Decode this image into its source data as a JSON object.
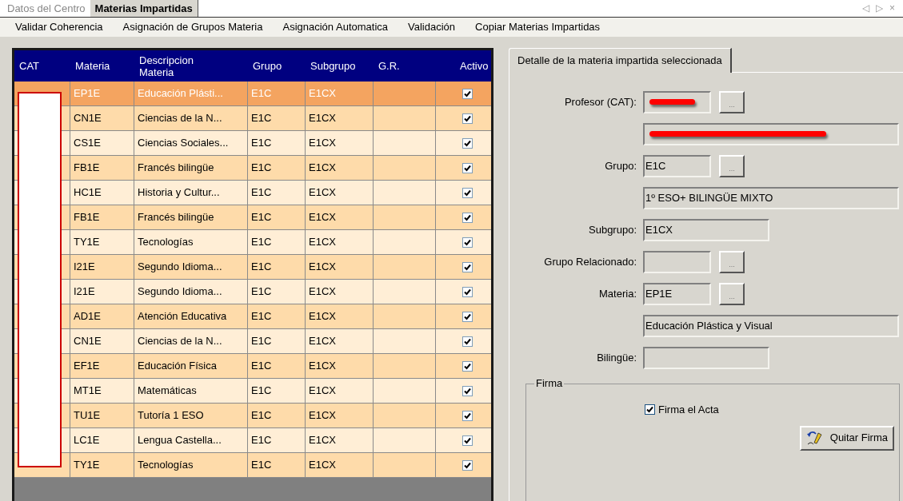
{
  "tabs": [
    {
      "label": "Datos del Centro",
      "selected": false
    },
    {
      "label": "Materias Impartidas",
      "selected": true
    }
  ],
  "nav_icons": [
    "◁",
    "▷",
    "×"
  ],
  "toolbar": [
    "Validar Coherencia",
    "Asignación de Grupos Materia",
    "Asignación Automatica",
    "Validación",
    "Copiar Materias Impartidas"
  ],
  "table": {
    "columns": [
      "CAT",
      "Materia",
      "Descripcion Materia",
      "Grupo",
      "Subgrupo",
      "G.R.",
      "Activo"
    ],
    "cat_redacted": true,
    "rows": [
      {
        "materia": "EP1E",
        "descripcion": "Educación Plásti...",
        "grupo": "E1C",
        "subgrupo": "E1CX",
        "activo": true,
        "selected": true
      },
      {
        "materia": "CN1E",
        "descripcion": "Ciencias de la N...",
        "grupo": "E1C",
        "subgrupo": "E1CX",
        "activo": true,
        "selected": false
      },
      {
        "materia": "CS1E",
        "descripcion": "Ciencias Sociales...",
        "grupo": "E1C",
        "subgrupo": "E1CX",
        "activo": true,
        "selected": false
      },
      {
        "materia": "FB1E",
        "descripcion": "Francés bilingüe",
        "grupo": "E1C",
        "subgrupo": "E1CX",
        "activo": true,
        "selected": false
      },
      {
        "materia": "HC1E",
        "descripcion": "Historia y Cultur...",
        "grupo": "E1C",
        "subgrupo": "E1CX",
        "activo": true,
        "selected": false
      },
      {
        "materia": "FB1E",
        "descripcion": "Francés bilingüe",
        "grupo": "E1C",
        "subgrupo": "E1CX",
        "activo": true,
        "selected": false
      },
      {
        "materia": "TY1E",
        "descripcion": "Tecnologías",
        "grupo": "E1C",
        "subgrupo": "E1CX",
        "activo": true,
        "selected": false
      },
      {
        "materia": "I21E",
        "descripcion": "Segundo Idioma...",
        "grupo": "E1C",
        "subgrupo": "E1CX",
        "activo": true,
        "selected": false
      },
      {
        "materia": "I21E",
        "descripcion": "Segundo Idioma...",
        "grupo": "E1C",
        "subgrupo": "E1CX",
        "activo": true,
        "selected": false
      },
      {
        "materia": "AD1E",
        "descripcion": "Atención Educativa",
        "grupo": "E1C",
        "subgrupo": "E1CX",
        "activo": true,
        "selected": false
      },
      {
        "materia": "CN1E",
        "descripcion": "Ciencias de la N...",
        "grupo": "E1C",
        "subgrupo": "E1CX",
        "activo": true,
        "selected": false
      },
      {
        "materia": "EF1E",
        "descripcion": "Educación Física",
        "grupo": "E1C",
        "subgrupo": "E1CX",
        "activo": true,
        "selected": false
      },
      {
        "materia": "MT1E",
        "descripcion": "Matemáticas",
        "grupo": "E1C",
        "subgrupo": "E1CX",
        "activo": true,
        "selected": false
      },
      {
        "materia": "TU1E",
        "descripcion": "Tutoría 1 ESO",
        "grupo": "E1C",
        "subgrupo": "E1CX",
        "activo": true,
        "selected": false
      },
      {
        "materia": "LC1E",
        "descripcion": "Lengua Castella...",
        "grupo": "E1C",
        "subgrupo": "E1CX",
        "activo": true,
        "selected": false
      },
      {
        "materia": "TY1E",
        "descripcion": "Tecnologías",
        "grupo": "E1C",
        "subgrupo": "E1CX",
        "activo": true,
        "selected": false
      }
    ]
  },
  "detail": {
    "tab": "Detalle de la materia impartida seleccionada",
    "rows": [
      {
        "kind": "code",
        "label": "Profesor (CAT):",
        "redacted": true,
        "browse": "..."
      },
      {
        "kind": "wide",
        "redacted": true
      },
      {
        "kind": "code",
        "label": "Grupo:",
        "value": "E1C",
        "redacted": false,
        "browse": "..."
      },
      {
        "kind": "wide",
        "value": "1º ESO+ BILINGÜE MIXTO",
        "redacted": false
      },
      {
        "kind": "medium",
        "label": "Subgrupo:",
        "value": "E1CX",
        "redacted": false
      },
      {
        "kind": "code",
        "label": "Grupo Relacionado:",
        "redacted": false,
        "browse": "..."
      },
      {
        "kind": "code",
        "label": "Materia:",
        "value": "EP1E",
        "redacted": false,
        "browse": "..."
      },
      {
        "kind": "wide",
        "value": "Educación Plástica y Visual",
        "redacted": false
      },
      {
        "kind": "medium",
        "label": "Bilingüe:",
        "redacted": false
      }
    ],
    "firma": {
      "title": "Firma",
      "checkbox": {
        "label": "Firma el Acta",
        "checked": true
      },
      "button": "Quitar Firma"
    }
  }
}
